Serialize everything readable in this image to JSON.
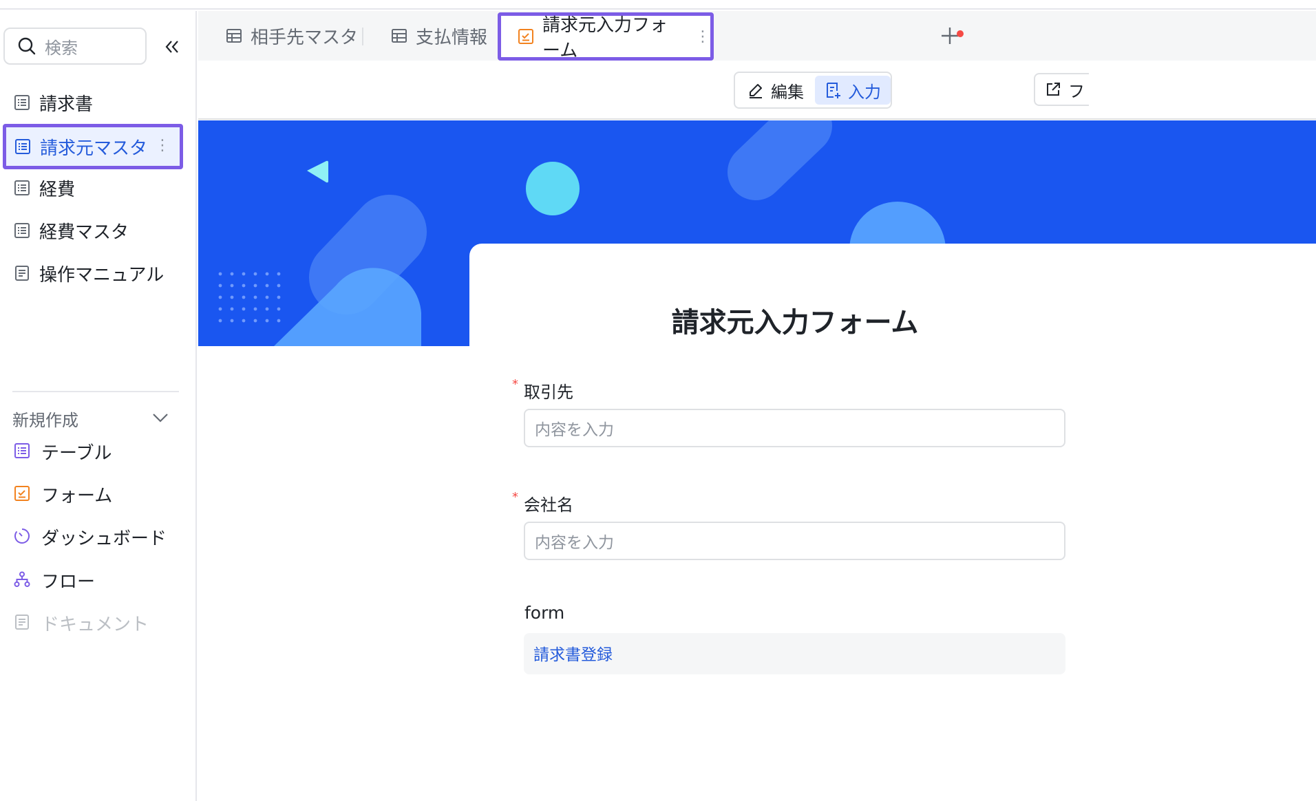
{
  "sidebar": {
    "search_placeholder": "検索",
    "items": [
      {
        "label": "請求書",
        "icon": "table-icon"
      },
      {
        "label": "請求元マスタ",
        "icon": "table-icon",
        "active": true
      },
      {
        "label": "経費",
        "icon": "table-icon"
      },
      {
        "label": "経費マスタ",
        "icon": "table-icon"
      },
      {
        "label": "操作マニュアル",
        "icon": "document-icon"
      }
    ],
    "create_section": {
      "label": "新規作成",
      "items": [
        {
          "label": "テーブル",
          "icon": "table-icon",
          "color": "#7c5ce6"
        },
        {
          "label": "フォーム",
          "icon": "form-icon",
          "color": "#f2821f"
        },
        {
          "label": "ダッシュボード",
          "icon": "dashboard-icon",
          "color": "#7c5ce6"
        },
        {
          "label": "フロー",
          "icon": "flow-icon",
          "color": "#7c5ce6"
        },
        {
          "label": "ドキュメント",
          "icon": "document-icon",
          "disabled": true
        }
      ]
    }
  },
  "tabs": [
    {
      "label": "相手先マスタ",
      "icon": "grid-icon"
    },
    {
      "label": "支払情報",
      "icon": "grid-icon"
    },
    {
      "label": "請求元入力フォーム",
      "icon": "form-icon",
      "active": true
    }
  ],
  "toolbar": {
    "edit_label": "編集",
    "input_label": "入力",
    "share_label": "フ"
  },
  "form": {
    "title": "請求元入力フォーム",
    "fields": [
      {
        "label": "取引先",
        "required": true,
        "placeholder": "内容を入力"
      },
      {
        "label": "会社名",
        "required": true,
        "placeholder": "内容を入力"
      }
    ],
    "extra_label": "form",
    "extra_link": "請求書登録"
  },
  "colors": {
    "accent": "#245bdb",
    "highlight_border": "#7c5ce6",
    "banner": "#1a56f0",
    "required": "#f54a45"
  }
}
